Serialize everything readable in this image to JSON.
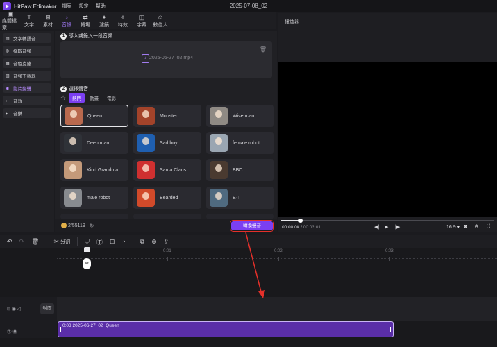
{
  "app": {
    "name": "HitPaw Edimakor",
    "doc_title": "2025-07-08_02",
    "menu": [
      "檔案",
      "設定",
      "幫助"
    ]
  },
  "toolbar": {
    "items": [
      {
        "label": "媒體檔案",
        "icon": "media-icon"
      },
      {
        "label": "文字",
        "icon": "text-icon"
      },
      {
        "label": "素材",
        "icon": "sticker-icon"
      },
      {
        "label": "音訊",
        "icon": "audio-icon",
        "active": true
      },
      {
        "label": "轉場",
        "icon": "transition-icon"
      },
      {
        "label": "濾鏡",
        "icon": "filter-icon"
      },
      {
        "label": "特效",
        "icon": "effects-icon"
      },
      {
        "label": "字幕",
        "icon": "subtitle-icon"
      },
      {
        "label": "數位人",
        "icon": "avatar-icon"
      }
    ]
  },
  "sidebar": {
    "items": [
      {
        "label": "文字轉語音",
        "icon": "tts-icon"
      },
      {
        "label": "擷取音頻",
        "icon": "mic-icon"
      },
      {
        "label": "音色克隆",
        "icon": "clone-icon"
      },
      {
        "label": "音頻下載器",
        "icon": "download-icon"
      },
      {
        "label": "影片變聲",
        "icon": "voice-changer-icon",
        "active": true
      },
      {
        "label": "音效",
        "icon": "caret-right-icon"
      },
      {
        "label": "音樂",
        "icon": "caret-right-icon"
      }
    ]
  },
  "main": {
    "step1": {
      "num": "1",
      "title": "導入或錄入一段音頻",
      "file": "2025-06-27_02.mp4"
    },
    "step2": {
      "num": "2",
      "title": "選擇聲音"
    },
    "tabs": [
      "熱門",
      "動畫",
      "電影"
    ],
    "voices": [
      {
        "name": "Queen",
        "color": "#b9694e",
        "selected": true
      },
      {
        "name": "Monster",
        "color": "#a3432a"
      },
      {
        "name": "Wise man",
        "color": "#8f8a84"
      },
      {
        "name": "Deep man",
        "color": "#2f3238"
      },
      {
        "name": "Sad boy",
        "color": "#1f5fb0"
      },
      {
        "name": "female robot",
        "color": "#9aa6b2"
      },
      {
        "name": "Kind Grandma",
        "color": "#c49a7a"
      },
      {
        "name": "Santa Claus",
        "color": "#cf3030"
      },
      {
        "name": "BBC",
        "color": "#4a3a30"
      },
      {
        "name": "male robot",
        "color": "#888b90"
      },
      {
        "name": "Bearded",
        "color": "#d14a2a"
      },
      {
        "name": "E·T",
        "color": "#4f6a80"
      }
    ],
    "credits": "2/55119",
    "convert_label": "轉換聲音"
  },
  "preview": {
    "title": "播放器",
    "current_time": "00:00:08",
    "total_time": "00:03:01",
    "aspect": "16:9",
    "progress": 0.09
  },
  "timeline_toolbar": {
    "split_label": "分割"
  },
  "timeline": {
    "ruler": [
      "0:01",
      "0:02",
      "0:03"
    ],
    "cover_label": "封面",
    "clip_label": "0:03 2025-06-27_02_Queen"
  },
  "colors": {
    "accent": "#7b3ff2",
    "highlight": "#e5302a"
  }
}
